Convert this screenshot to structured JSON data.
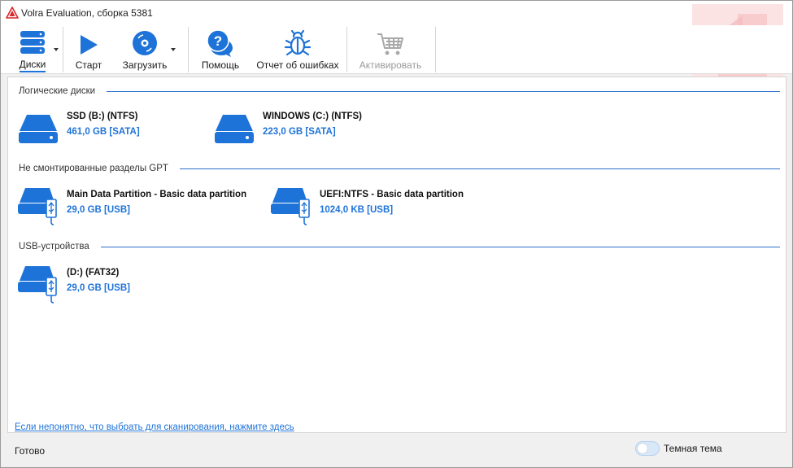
{
  "window": {
    "title": "Volra Evaluation, сборка 5381"
  },
  "toolbar": {
    "disks_label": "Диски",
    "start_label": "Старт",
    "load_label": "Загрузить",
    "help_label": "Помощь",
    "report_label": "Отчет об ошибках",
    "activate_label": "Активировать"
  },
  "icons": {
    "disks": "stacked-disks-icon",
    "start": "play-icon",
    "load": "disc-icon",
    "help": "question-chat-icon",
    "report": "bug-icon",
    "activate": "cart-icon",
    "drive": "hard-drive-icon",
    "usb_drive": "usb-drive-icon"
  },
  "colors": {
    "accent": "#1e73d8",
    "disabled": "#9a9a9a",
    "brand_red": "#d9262b"
  },
  "sections": {
    "logical": {
      "title": "Логические диски",
      "devices": [
        {
          "name": "SSD (B:) (NTFS)",
          "size": "461,0 GB [SATA]"
        },
        {
          "name": "WINDOWS (C:) (NTFS)",
          "size": "223,0 GB [SATA]"
        }
      ]
    },
    "gpt": {
      "title": "Не смонтированные разделы GPT",
      "devices": [
        {
          "name": "Main Data Partition - Basic data partition",
          "size": "29,0 GB [USB]"
        },
        {
          "name": "UEFI:NTFS - Basic data partition",
          "size": "1024,0 KB [USB]"
        }
      ]
    },
    "usb": {
      "title": "USB-устройства",
      "devices": [
        {
          "name": "(D:) (FAT32)",
          "size": "29,0 GB [USB]"
        }
      ]
    }
  },
  "help_link": "Если непонятно, что выбрать для сканирования, нажмите здесь",
  "status": {
    "text": "Готово",
    "dark_theme_label": "Темная тема",
    "dark_theme_on": false
  }
}
